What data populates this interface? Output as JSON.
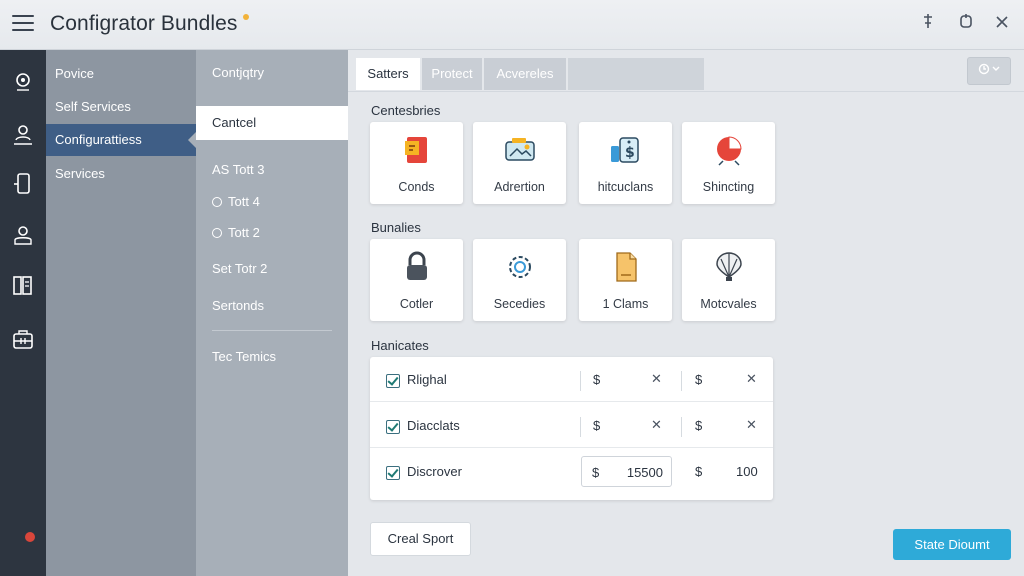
{
  "app": {
    "title": "Configrator Bundles",
    "accent": "#2eaad8"
  },
  "window_controls": {
    "pin": "pin-icon",
    "maximize": "maximize-icon",
    "close": "close-icon"
  },
  "rail": {
    "icons": [
      "settings-icon",
      "user-icon",
      "mobile-icon",
      "cloud-user-icon",
      "book-icon",
      "database-icon"
    ]
  },
  "nav1": {
    "items": [
      "Povice",
      "Self Services",
      "Configurattiess",
      "Services"
    ]
  },
  "nav2": {
    "header": "Contjqtry",
    "items": [
      "Cantcel",
      "AS Tott 3",
      "Tott 4",
      "Tott 2",
      "Set Totr 2",
      "Sertonds",
      "Tec Temics"
    ]
  },
  "tabs": [
    "Satters",
    "Protect",
    "Acvereles"
  ],
  "sections": {
    "categories": {
      "title": "Centesbries",
      "cards": [
        {
          "label": "Conds",
          "icon": "document-icon"
        },
        {
          "label": "Adrertion",
          "icon": "wallet-icon"
        },
        {
          "label": "hitcuclans",
          "icon": "money-tag-icon"
        },
        {
          "label": "Shincting",
          "icon": "pie-chart-icon"
        }
      ]
    },
    "bundles": {
      "title": "Bunalies",
      "cards": [
        {
          "label": "Cotler",
          "icon": "lock-icon"
        },
        {
          "label": "Secedies",
          "icon": "gear-icon"
        },
        {
          "label": "1 Clams",
          "icon": "file-icon"
        },
        {
          "label": "Motcvales",
          "icon": "balloon-icon"
        }
      ]
    },
    "handicaps": {
      "title": "Hanicates",
      "rows": [
        {
          "label": "Rlighal",
          "cur1": "$",
          "cur2": "$"
        },
        {
          "label": "Diacclats",
          "cur1": "$",
          "cur2": "$"
        },
        {
          "label": "Discrover",
          "cur1": "$",
          "value1": "15500",
          "cur2": "$",
          "value2": "100"
        }
      ]
    }
  },
  "buttons": {
    "secondary": "Creal Sport",
    "primary": "State Dioumt"
  }
}
